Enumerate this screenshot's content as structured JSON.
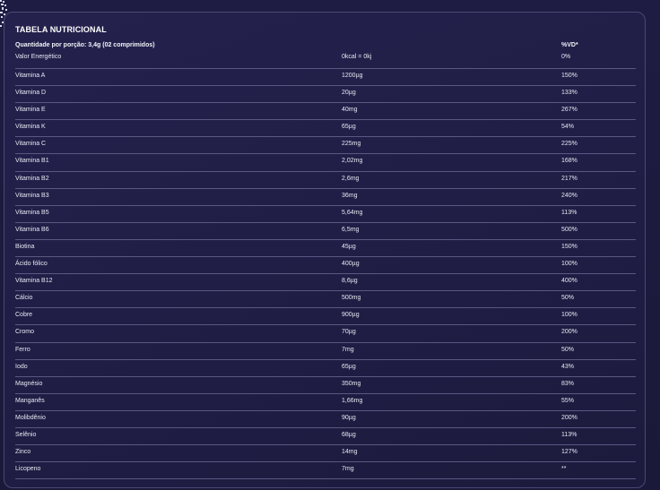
{
  "title": "TABELA NUTRICIONAL",
  "header": {
    "serving": "Quantidade por porção: 3,4g (02 comprimidos)",
    "vd": "%VD*"
  },
  "rows": [
    {
      "name": "Valor Energético",
      "amount": "0kcal = 0kj",
      "vd": "0%"
    },
    {
      "name": "Vitamina A",
      "amount": "1200µg",
      "vd": "150%"
    },
    {
      "name": "Vitamina D",
      "amount": "20µg",
      "vd": "133%"
    },
    {
      "name": "Vitamina E",
      "amount": "40mg",
      "vd": "267%"
    },
    {
      "name": "Vitamina K",
      "amount": "65µg",
      "vd": "54%"
    },
    {
      "name": "Vitamina C",
      "amount": "225mg",
      "vd": "225%"
    },
    {
      "name": "Vitamina B1",
      "amount": "2,02mg",
      "vd": "168%"
    },
    {
      "name": "Vitamina B2",
      "amount": "2,6mg",
      "vd": "217%"
    },
    {
      "name": "Vitamina B3",
      "amount": "36mg",
      "vd": "240%"
    },
    {
      "name": "Vitamina B5",
      "amount": "5,64mg",
      "vd": "113%"
    },
    {
      "name": "Vitamina B6",
      "amount": "6,5mg",
      "vd": "500%"
    },
    {
      "name": "Biotina",
      "amount": "45µg",
      "vd": "150%"
    },
    {
      "name": "Ácido fólico",
      "amount": "400µg",
      "vd": "100%"
    },
    {
      "name": "Vitamina B12",
      "amount": "8,6µg",
      "vd": "400%"
    },
    {
      "name": "Cálcio",
      "amount": "500mg",
      "vd": "50%"
    },
    {
      "name": "Cobre",
      "amount": "900µg",
      "vd": "100%"
    },
    {
      "name": "Cromo",
      "amount": "70µg",
      "vd": "200%"
    },
    {
      "name": "Ferro",
      "amount": "7mg",
      "vd": "50%"
    },
    {
      "name": "Iodo",
      "amount": "65µg",
      "vd": "43%"
    },
    {
      "name": "Magnésio",
      "amount": "350mg",
      "vd": "83%"
    },
    {
      "name": "Manganês",
      "amount": "1,66mg",
      "vd": "55%"
    },
    {
      "name": "Molibdênio",
      "amount": "90µg",
      "vd": "200%"
    },
    {
      "name": "Selênio",
      "amount": "68µg",
      "vd": "113%"
    },
    {
      "name": "Zinco",
      "amount": "14mg",
      "vd": "127%"
    },
    {
      "name": "Licopeno",
      "amount": "7mg",
      "vd": "**"
    }
  ]
}
